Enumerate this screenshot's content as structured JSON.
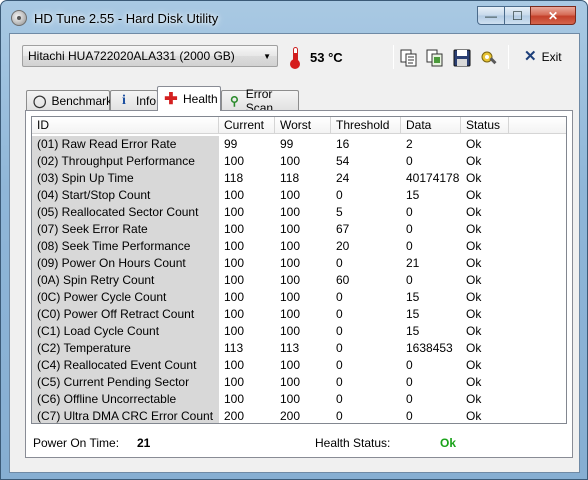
{
  "window": {
    "title": "HD Tune 2.55 - Hard Disk Utility"
  },
  "captions": {
    "minimize": "—",
    "maximize": "☐",
    "close": "✕"
  },
  "toolbar": {
    "drive": "Hitachi HUA722020ALA331 (2000 GB)",
    "temperature": "53 °C",
    "icons": [
      "copy-text-icon",
      "copy-screen-icon",
      "save-icon",
      "options-icon"
    ],
    "exit_label": "Exit"
  },
  "tabs": [
    {
      "label": "Benchmark",
      "icon": "lightbulb-icon"
    },
    {
      "label": "Info",
      "icon": "info-icon"
    },
    {
      "label": "Health",
      "icon": "red-cross-icon",
      "active": true
    },
    {
      "label": "Error Scan",
      "icon": "magnifier-icon"
    }
  ],
  "table": {
    "columns": [
      "ID",
      "Current",
      "Worst",
      "Threshold",
      "Data",
      "Status"
    ],
    "rows": [
      [
        "(01) Raw Read Error Rate",
        "99",
        "99",
        "16",
        "2",
        "Ok"
      ],
      [
        "(02) Throughput Performance",
        "100",
        "100",
        "54",
        "0",
        "Ok"
      ],
      [
        "(03) Spin Up Time",
        "118",
        "118",
        "24",
        "40174178",
        "Ok"
      ],
      [
        "(04) Start/Stop Count",
        "100",
        "100",
        "0",
        "15",
        "Ok"
      ],
      [
        "(05) Reallocated Sector Count",
        "100",
        "100",
        "5",
        "0",
        "Ok"
      ],
      [
        "(07) Seek Error Rate",
        "100",
        "100",
        "67",
        "0",
        "Ok"
      ],
      [
        "(08) Seek Time Performance",
        "100",
        "100",
        "20",
        "0",
        "Ok"
      ],
      [
        "(09) Power On Hours Count",
        "100",
        "100",
        "0",
        "21",
        "Ok"
      ],
      [
        "(0A) Spin Retry Count",
        "100",
        "100",
        "60",
        "0",
        "Ok"
      ],
      [
        "(0C) Power Cycle Count",
        "100",
        "100",
        "0",
        "15",
        "Ok"
      ],
      [
        "(C0) Power Off Retract Count",
        "100",
        "100",
        "0",
        "15",
        "Ok"
      ],
      [
        "(C1) Load Cycle Count",
        "100",
        "100",
        "0",
        "15",
        "Ok"
      ],
      [
        "(C2) Temperature",
        "113",
        "113",
        "0",
        "1638453",
        "Ok"
      ],
      [
        "(C4) Reallocated Event Count",
        "100",
        "100",
        "0",
        "0",
        "Ok"
      ],
      [
        "(C5) Current Pending Sector",
        "100",
        "100",
        "0",
        "0",
        "Ok"
      ],
      [
        "(C6) Offline Uncorrectable",
        "100",
        "100",
        "0",
        "0",
        "Ok"
      ],
      [
        "(C7) Ultra DMA CRC Error Count",
        "200",
        "200",
        "0",
        "0",
        "Ok"
      ]
    ]
  },
  "footer": {
    "power_on_label": "Power On Time:",
    "power_on_value": "21",
    "health_label": "Health Status:",
    "health_value": "Ok",
    "health_color": "#1aa31a"
  }
}
